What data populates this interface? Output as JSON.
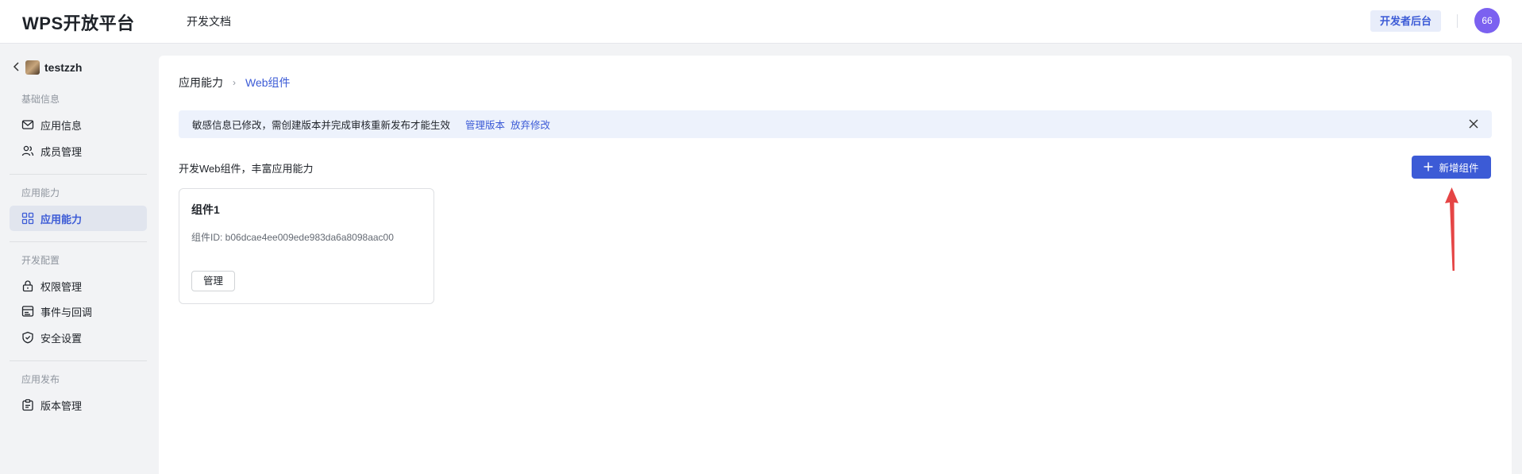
{
  "header": {
    "logo": "WPS开放平台",
    "nav_doc": "开发文档",
    "dev_console": "开发者后台",
    "avatar_text": "66"
  },
  "sidebar": {
    "app_name": "testzzh",
    "groups": [
      {
        "title": "基础信息",
        "items": [
          {
            "label": "应用信息",
            "icon": "mail-icon"
          },
          {
            "label": "成员管理",
            "icon": "members-icon"
          }
        ]
      },
      {
        "title": "应用能力",
        "items": [
          {
            "label": "应用能力",
            "icon": "grid-icon",
            "active": true
          }
        ]
      },
      {
        "title": "开发配置",
        "items": [
          {
            "label": "权限管理",
            "icon": "lock-icon"
          },
          {
            "label": "事件与回调",
            "icon": "event-icon"
          },
          {
            "label": "安全设置",
            "icon": "shield-icon"
          }
        ]
      },
      {
        "title": "应用发布",
        "items": [
          {
            "label": "版本管理",
            "icon": "version-icon"
          }
        ]
      }
    ]
  },
  "breadcrumb": {
    "parent": "应用能力",
    "separator": "›",
    "current": "Web组件"
  },
  "notice": {
    "message": "敏感信息已修改，需创建版本并完成审核重新发布才能生效",
    "link_manage": "管理版本",
    "link_discard": "放弃修改"
  },
  "main": {
    "description": "开发Web组件，丰富应用能力",
    "add_button": "新增组件",
    "cards": [
      {
        "name": "组件1",
        "id_text": "组件ID: b06dcae4ee009ede983da6a8098aac00",
        "manage_label": "管理"
      }
    ]
  },
  "colors": {
    "accent": "#3c5bd6",
    "annotation_arrow": "#e54545"
  }
}
